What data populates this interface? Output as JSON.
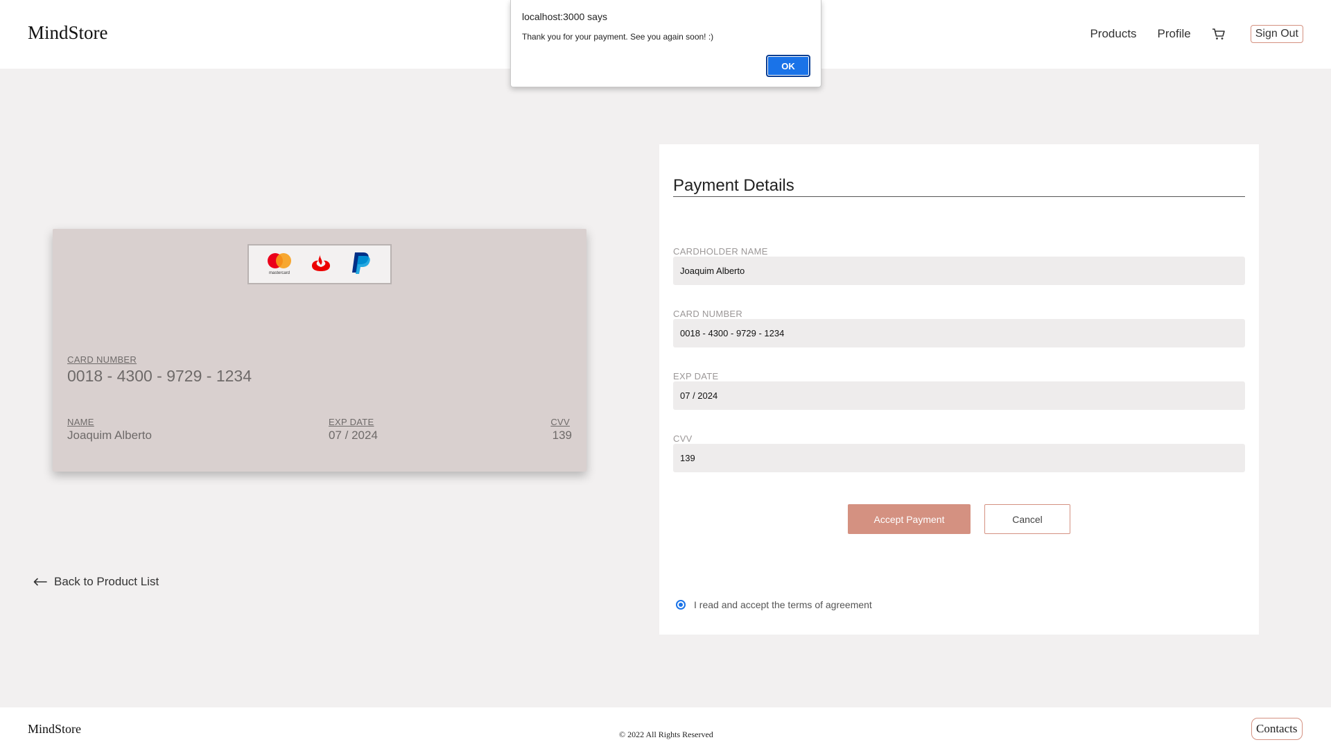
{
  "header": {
    "brand": "MindStore",
    "nav": {
      "products": "Products",
      "profile": "Profile",
      "sign_out": "Sign Out"
    },
    "cart_icon": "cart-icon"
  },
  "card_preview": {
    "logos": [
      "mastercard-logo",
      "santander-logo",
      "paypal-logo"
    ],
    "mastercard_text": "mastercard",
    "card_number_label": "CARD NUMBER",
    "card_number": "0018 - 4300 - 9729 - 1234",
    "name_label": "NAME",
    "name": "Joaquim Alberto",
    "exp_label": "EXP DATE",
    "exp": "07 / 2024",
    "cvv_label": "CVV",
    "cvv": "139"
  },
  "back_link": {
    "label": "Back to Product List",
    "icon": "arrow-left-icon"
  },
  "payment": {
    "title": "Payment Details",
    "fields": [
      {
        "label": "CARDHOLDER NAME",
        "value": "Joaquim Alberto"
      },
      {
        "label": "CARD NUMBER",
        "value": "0018 - 4300 - 9729 - 1234"
      },
      {
        "label": "EXP DATE",
        "value": "07 / 2024"
      },
      {
        "label": "CVV",
        "value": "139"
      }
    ],
    "accept_label": "Accept Payment",
    "cancel_label": "Cancel",
    "terms_label": "I read and accept the terms of agreement",
    "terms_checked": true
  },
  "footer": {
    "brand": "MindStore",
    "copyright": "© 2022 All Rights Reserved",
    "contacts_label": "Contacts"
  },
  "dialog": {
    "title": "localhost:3000 says",
    "message": "Thank you for your payment. See you again soon! :)",
    "ok_label": "OK"
  },
  "colors": {
    "accent": "#d49181",
    "card_bg": "#d9d0cf",
    "page_bg": "#f2f0f0",
    "dialog_button": "#1a73e8"
  }
}
